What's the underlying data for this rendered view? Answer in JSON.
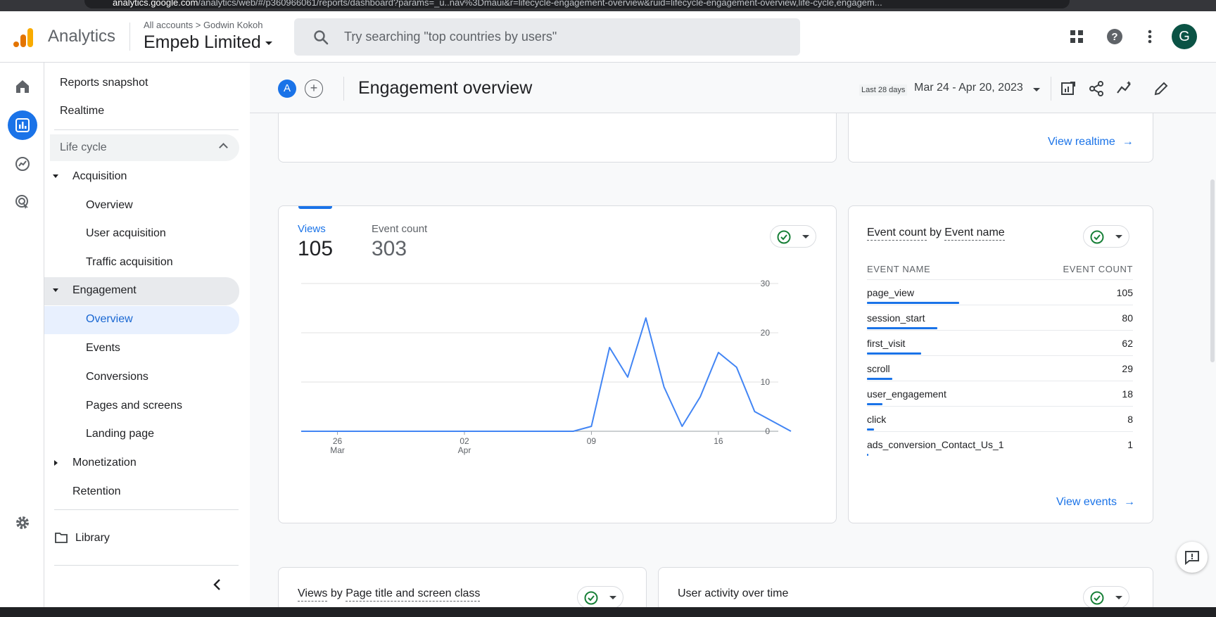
{
  "browser": {
    "url_host": "analytics.google.com",
    "url_rest": "/analytics/web/#/p360966061/reports/dashboard?params=_u..nav%3Dmaui&r=lifecycle-engagement-overview&ruid=lifecycle-engagement-overview,life-cycle,engagem..."
  },
  "header": {
    "brand": "Analytics",
    "breadcrumb": {
      "account": "All accounts",
      "separator": ">",
      "property_owner": "Godwin Kokoh"
    },
    "property": "Empeb Limited",
    "search_placeholder": "Try searching \"top countries by users\"",
    "avatar_letter": "G"
  },
  "nav": {
    "items": [
      {
        "label": "Reports snapshot"
      },
      {
        "label": "Realtime"
      },
      {
        "label": "Life cycle"
      },
      {
        "label": "Acquisition"
      },
      {
        "label": "Overview"
      },
      {
        "label": "User acquisition"
      },
      {
        "label": "Traffic acquisition"
      },
      {
        "label": "Engagement"
      },
      {
        "label": "Overview"
      },
      {
        "label": "Events"
      },
      {
        "label": "Conversions"
      },
      {
        "label": "Pages and screens"
      },
      {
        "label": "Landing page"
      },
      {
        "label": "Monetization"
      },
      {
        "label": "Retention"
      }
    ],
    "library": "Library"
  },
  "toolbar": {
    "comparison_badge": "A",
    "plus": "+",
    "title": "Engagement overview",
    "date_preset": "Last 28 days",
    "date_range": "Mar 24 - Apr 20, 2023"
  },
  "top_cards": {
    "realtime_link": "View realtime",
    "arrow": "→"
  },
  "views_card": {
    "metrics": [
      {
        "label": "Views",
        "value": "105"
      },
      {
        "label": "Event count",
        "value": "303"
      }
    ],
    "chart_data": {
      "type": "line",
      "x": [
        "Mar 24",
        "Mar 25",
        "Mar 26",
        "Mar 27",
        "Mar 28",
        "Mar 29",
        "Mar 30",
        "Mar 31",
        "Apr 1",
        "Apr 2",
        "Apr 3",
        "Apr 4",
        "Apr 5",
        "Apr 6",
        "Apr 7",
        "Apr 8",
        "Apr 9",
        "Apr 10",
        "Apr 11",
        "Apr 12",
        "Apr 13",
        "Apr 14",
        "Apr 15",
        "Apr 16",
        "Apr 17",
        "Apr 18",
        "Apr 19",
        "Apr 20"
      ],
      "series": [
        {
          "values": [
            0,
            0,
            0,
            0,
            0,
            0,
            0,
            0,
            0,
            0,
            0,
            0,
            0,
            0,
            0,
            0,
            1,
            17,
            11,
            23,
            9,
            1,
            7,
            16,
            13,
            4,
            2,
            0
          ],
          "color": "#4285f4"
        }
      ],
      "ylim": [
        0,
        30
      ],
      "yticks": [
        "30",
        "20",
        "10",
        "0"
      ],
      "xticks": [
        {
          "day": "26",
          "month": "Mar"
        },
        {
          "day": "02",
          "month": "Apr"
        },
        {
          "day": "09",
          "month": ""
        },
        {
          "day": "16",
          "month": ""
        }
      ],
      "grid": true
    }
  },
  "events_card": {
    "title_prefix": "Event count",
    "title_mid": " by ",
    "title_dim": "Event name",
    "col_name": "EVENT NAME",
    "col_count": "EVENT COUNT",
    "rows": [
      {
        "name": "page_view",
        "count": "105",
        "value": 105
      },
      {
        "name": "session_start",
        "count": "80",
        "value": 80
      },
      {
        "name": "first_visit",
        "count": "62",
        "value": 62
      },
      {
        "name": "scroll",
        "count": "29",
        "value": 29
      },
      {
        "name": "user_engagement",
        "count": "18",
        "value": 18
      },
      {
        "name": "click",
        "count": "8",
        "value": 8
      },
      {
        "name": "ads_conversion_Contact_Us_1",
        "count": "1",
        "value": 1
      }
    ],
    "link": "View events",
    "arrow": "→"
  },
  "bottom_cards": {
    "left_title_a": "Views",
    "left_title_b": " by ",
    "left_title_c": "Page title and screen class",
    "right_title": "User activity over time"
  },
  "colors": {
    "accent": "#1a73e8",
    "line": "#4285f4",
    "ok_green": "#188038"
  }
}
